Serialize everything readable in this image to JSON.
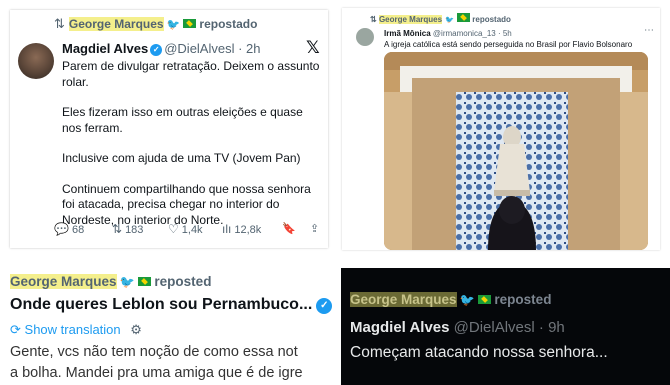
{
  "panel1": {
    "repost_name": "George Marques",
    "repost_suffix": "repostado",
    "author": "Magdiel Alves",
    "handle": "@DielAlvesl · 2h",
    "paragraphs": [
      "Parem de divulgar retratação. Deixem o assunto rolar.",
      "Eles fizeram isso em outras eleições e quase nos ferram.",
      "Inclusive com ajuda de uma TV (Jovem Pan)",
      "Continuem compartilhando que nossa senhora foi atacada, precisa chegar no interior do Nordeste, no interior do Norte."
    ],
    "replies": "68",
    "reposts": "183",
    "likes": "1,4k",
    "views": "12,8k"
  },
  "panel2": {
    "repost_name": "George Marques",
    "repost_suffix": "repostado",
    "author": "Irmã Mônica",
    "handle": "@irmamonica_13 · 5h",
    "text": "A igreja católica está sendo perseguida no Brasil por Flavio Bolsonaro"
  },
  "panel3": {
    "repost_name": "George Marques",
    "repost_suffix": "reposted",
    "title": "Onde queres Leblon sou Pernambuco...",
    "translate": "Show translation",
    "line1": "Gente, vcs não tem noção de como essa not",
    "line2": "a bolha. Mandei pra uma amiga que é de igre"
  },
  "panel4": {
    "repost_name": "George Marques",
    "repost_suffix": "reposted",
    "author": "Magdiel Alves",
    "handle": "@DielAlvesl · 9h",
    "text": "Começam atacando nossa senhora..."
  },
  "colors": {
    "highlight": "#f4ef8c",
    "link": "#1d9bf0",
    "dark_bg": "#05070a"
  }
}
